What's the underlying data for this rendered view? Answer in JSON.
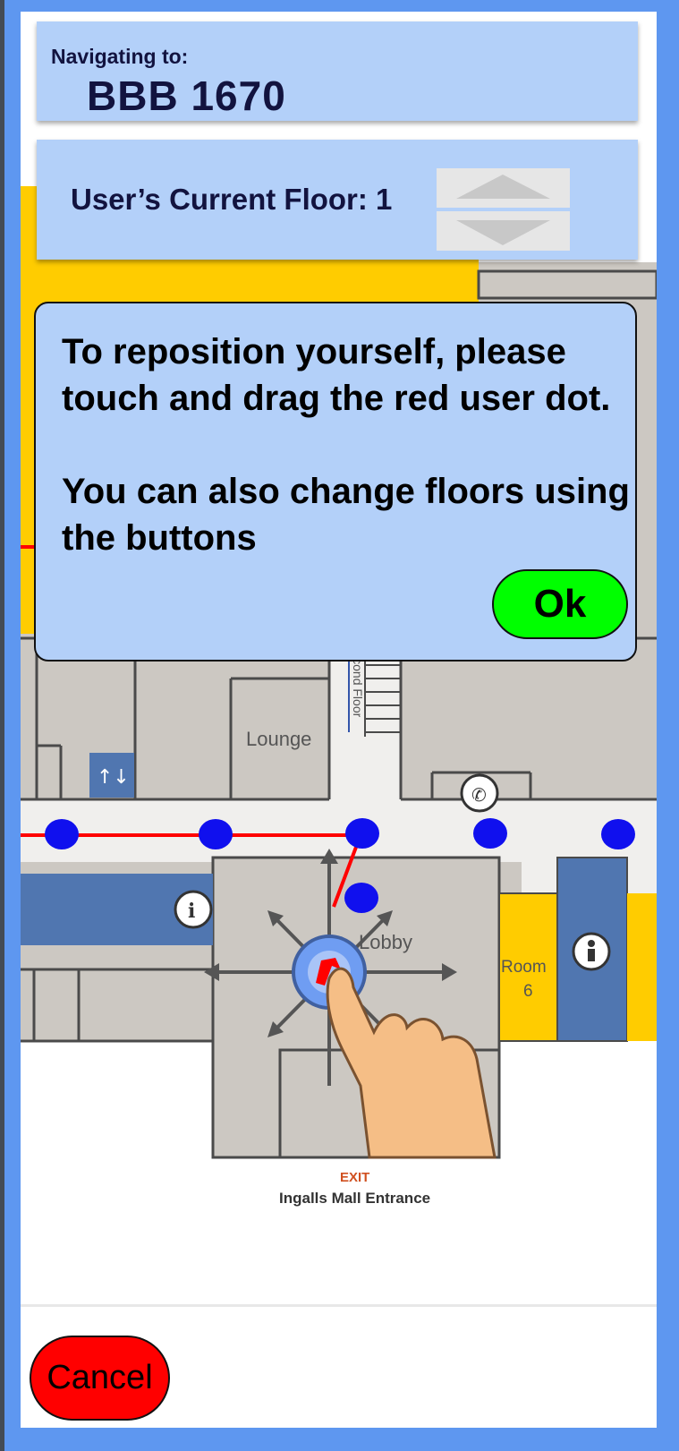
{
  "navigation": {
    "label": "Navigating to:",
    "destination": "BBB 1670"
  },
  "floor": {
    "label": "User’s Current Floor: 1",
    "up_icon": "triangle-up-icon",
    "down_icon": "triangle-down-icon"
  },
  "dialog": {
    "line1": "To reposition yourself, please touch and drag the red user dot.",
    "line2": "You can also change floors using the buttons",
    "ok_label": "Ok"
  },
  "map": {
    "room_lounge": "Lounge",
    "room_lobby": "Lobby",
    "room_6_name": "Room",
    "room_6_number": "6",
    "stairs_label": "Second Floor",
    "exit_label": "EXIT",
    "entrance_label": "Ingalls Mall Entrance",
    "elevator_icon": "elevator-icon",
    "info_icon": "info-icon",
    "phone_icon": "phone-icon",
    "restroom_icon": "restroom-icon",
    "gesture_icon": "drag-hand-icon"
  },
  "cancel_label": "Cancel",
  "colors": {
    "frame": "#5e97f0",
    "card": "#b3d0f9",
    "ok": "#00ff00",
    "cancel": "#ff0000",
    "route": "#ff0000",
    "waypoint": "#1010ee",
    "room_yellow": "#ffcc00",
    "room_blue": "#5076b0"
  }
}
